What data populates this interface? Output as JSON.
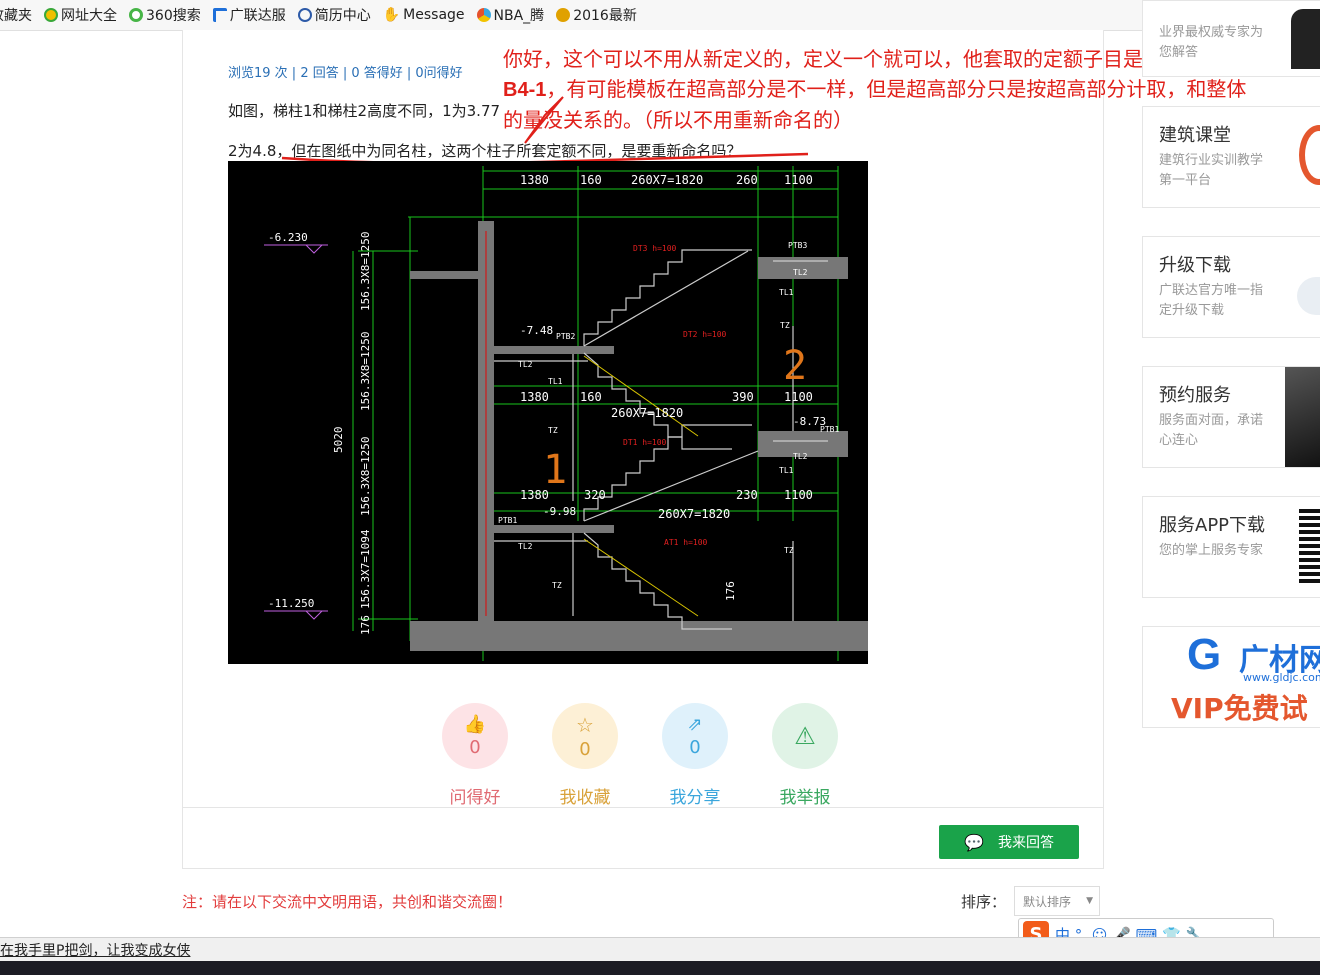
{
  "bookmarks": [
    {
      "label": "收藏夹",
      "icon": "star-icon",
      "color": "#e8a800"
    },
    {
      "label": "网址大全",
      "icon": "grid-icon",
      "color": "#3aa83a"
    },
    {
      "label": "360搜索",
      "icon": "search-icon",
      "color": "#47b547"
    },
    {
      "label": "广联达服",
      "icon": "gld-icon",
      "color": "#1e6fd9"
    },
    {
      "label": "简历中心",
      "icon": "globe-icon",
      "color": "#2d5aa8"
    },
    {
      "label": "Message",
      "icon": "hand-icon",
      "color": "#3a76c4"
    },
    {
      "label": "NBA_腾",
      "icon": "tencent-icon",
      "color": "#e5522d"
    },
    {
      "label": "2016最新",
      "icon": "coin-icon",
      "color": "#e0a100"
    }
  ],
  "question": {
    "stats": "浏览19 次 | 2 回答 | 0 答得好 | 0问得好",
    "line1": "如图，梯柱1和梯柱2高度不同，1为3.77",
    "line2": "2为4.8，但在图纸中为同名柱，这两个柱子所套定额不同，是要重新命名吗？"
  },
  "annotation": {
    "part1": "你好，这个可以不用从新定义的，定义一个就可以，他套取的定额子目是一样的都是",
    "code": "B4-1",
    "part2": "，有可能模板在超高部分是不一样，但是超高部分只是按超高部分计取，和整体的量没关系的。（所以不用重新命名的）",
    "color": "#e0201a"
  },
  "cad": {
    "dims_top": [
      "1380",
      "160",
      "260X7=1820",
      "260",
      "1100"
    ],
    "dims_mid1": [
      "1380",
      "160",
      "260X7=1820",
      "390",
      "1100"
    ],
    "dims_mid2": [
      "1380",
      "320",
      "260X7=1820",
      "230",
      "1100"
    ],
    "levels": [
      "-6.230",
      "-7.48",
      "-8.73",
      "-9.98",
      "-11.250"
    ],
    "vertical": [
      "156.3X8=1250",
      "156.3X8=1250",
      "156.3X8=1250",
      "156.3X7=1094",
      "176",
      "5020",
      "176"
    ],
    "labels": [
      "PTB3",
      "PTB2",
      "PTB1",
      "PTB1",
      "TL2",
      "TL1",
      "TZ",
      "TL2",
      "TL1",
      "TL2",
      "TL1",
      "TL2",
      "TZ",
      "TZ",
      "TZ"
    ],
    "flight_numbers": [
      "1",
      "2"
    ],
    "notes_red": [
      "DT3 h=100",
      "DT2 h=100",
      "DT1 h=100",
      "AT1 h=100"
    ]
  },
  "actions": [
    {
      "label": "问得好",
      "count": "0",
      "icon": "thumbs-up-icon",
      "color": "#e06b73",
      "bg": "#fde3e6"
    },
    {
      "label": "我收藏",
      "count": "0",
      "icon": "star-outline-icon",
      "color": "#d9a23a",
      "bg": "#fdf0d6"
    },
    {
      "label": "我分享",
      "count": "0",
      "icon": "share-icon",
      "color": "#3ba6dc",
      "bg": "#dff1fb"
    },
    {
      "label": "我举报",
      "count": "",
      "icon": "warning-icon",
      "color": "#3aa860",
      "bg": "#e0f3e6"
    }
  ],
  "answer_button": "我来回答",
  "note": "注：请在以下交流中文明用语，共创和谐交流圈！",
  "sort": {
    "label": "排序：",
    "selected": "默认排序"
  },
  "sidebar": [
    {
      "title": "",
      "desc": "业界最权威专家为您解答",
      "icon": "expert-icon"
    },
    {
      "title": "建筑课堂",
      "desc": "建筑行业实训教学第一平台",
      "icon": "classroom-icon"
    },
    {
      "title": "升级下载",
      "desc": "广联达官方唯一指定升级下载",
      "icon": "cloud-download-icon"
    },
    {
      "title": "预约服务",
      "desc": "服务面对面，承诺心连心",
      "icon": "person-icon"
    },
    {
      "title": "服务APP下载",
      "desc": "您的掌上服务专家",
      "icon": "qr-code-icon"
    },
    {
      "title": "广材网",
      "desc": "VIP免费试",
      "icon": "guangcai-logo"
    }
  ],
  "ad_text": {
    "site": "www.gldjc.com"
  },
  "statusbar": "在我手里P把剑，让我变成女侠",
  "ime": {
    "glyphs": "中 °, ☺ 🎤 ⌨ 👕 🔧"
  }
}
